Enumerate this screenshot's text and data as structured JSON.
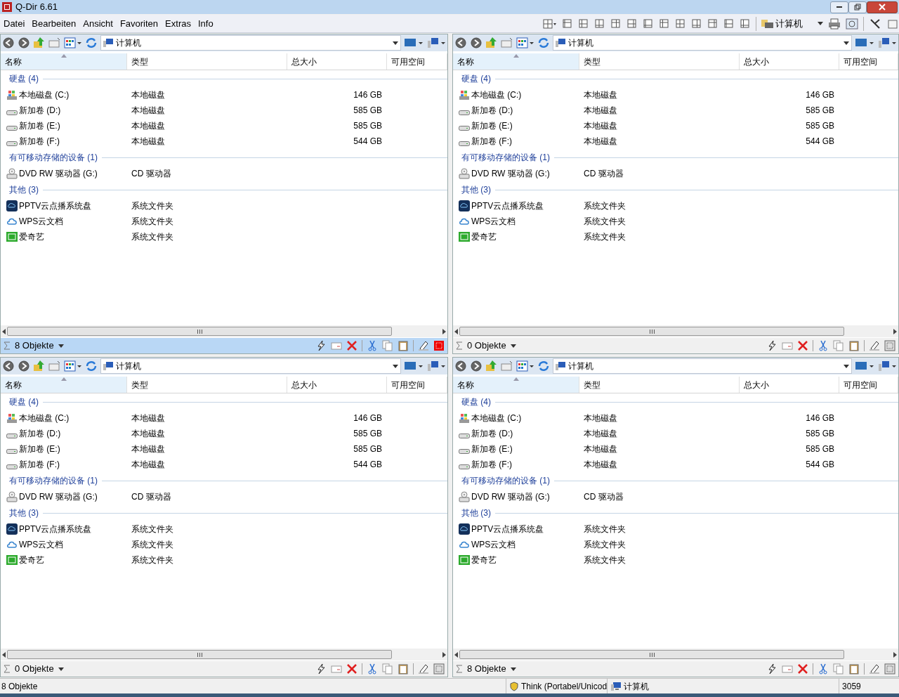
{
  "window": {
    "title": "Q-Dir 6.61"
  },
  "menu": [
    "Datei",
    "Bearbeiten",
    "Ansicht",
    "Favoriten",
    "Extras",
    "Info"
  ],
  "layout_toolbar": {
    "location": "计算机"
  },
  "panes": [
    {
      "active": true,
      "address": "计算机",
      "columns": [
        "名称",
        "类型",
        "总大小",
        "可用空间"
      ],
      "groups": [
        {
          "title": "硬盘 (4)",
          "items": [
            {
              "kind": "system-drive",
              "name": "本地磁盘 (C:)",
              "type": "本地磁盘",
              "size": "146 GB"
            },
            {
              "kind": "drive",
              "name": "新加卷 (D:)",
              "type": "本地磁盘",
              "size": "585 GB"
            },
            {
              "kind": "drive",
              "name": "新加卷 (E:)",
              "type": "本地磁盘",
              "size": "585 GB"
            },
            {
              "kind": "drive",
              "name": "新加卷 (F:)",
              "type": "本地磁盘",
              "size": "544 GB"
            }
          ]
        },
        {
          "title": "有可移动存储的设备 (1)",
          "items": [
            {
              "kind": "dvd",
              "name": "DVD RW 驱动器 (G:)",
              "type": "CD 驱动器"
            }
          ]
        },
        {
          "title": "其他 (3)",
          "items": [
            {
              "kind": "tv",
              "name": "PPTV云点播系统盘",
              "type": "系统文件夹"
            },
            {
              "kind": "cloud",
              "name": "WPS云文档",
              "type": "系统文件夹"
            },
            {
              "kind": "video",
              "name": "爱奇艺",
              "type": "系统文件夹"
            }
          ]
        }
      ],
      "status": "8 Objekte"
    },
    {
      "active": false,
      "address": "计算机",
      "columns": [
        "名称",
        "类型",
        "总大小",
        "可用空间"
      ],
      "groups": [
        {
          "title": "硬盘 (4)",
          "items": [
            {
              "kind": "system-drive",
              "name": "本地磁盘 (C:)",
              "type": "本地磁盘",
              "size": "146 GB"
            },
            {
              "kind": "drive",
              "name": "新加卷 (D:)",
              "type": "本地磁盘",
              "size": "585 GB"
            },
            {
              "kind": "drive",
              "name": "新加卷 (E:)",
              "type": "本地磁盘",
              "size": "585 GB"
            },
            {
              "kind": "drive",
              "name": "新加卷 (F:)",
              "type": "本地磁盘",
              "size": "544 GB"
            }
          ]
        },
        {
          "title": "有可移动存储的设备 (1)",
          "items": [
            {
              "kind": "dvd",
              "name": "DVD RW 驱动器 (G:)",
              "type": "CD 驱动器"
            }
          ]
        },
        {
          "title": "其他 (3)",
          "items": [
            {
              "kind": "tv",
              "name": "PPTV云点播系统盘",
              "type": "系统文件夹"
            },
            {
              "kind": "cloud",
              "name": "WPS云文档",
              "type": "系统文件夹"
            },
            {
              "kind": "video",
              "name": "爱奇艺",
              "type": "系统文件夹"
            }
          ]
        }
      ],
      "status": "0 Objekte"
    },
    {
      "active": false,
      "address": "计算机",
      "columns": [
        "名称",
        "类型",
        "总大小",
        "可用空间"
      ],
      "groups": [
        {
          "title": "硬盘 (4)",
          "items": [
            {
              "kind": "system-drive",
              "name": "本地磁盘 (C:)",
              "type": "本地磁盘",
              "size": "146 GB"
            },
            {
              "kind": "drive",
              "name": "新加卷 (D:)",
              "type": "本地磁盘",
              "size": "585 GB"
            },
            {
              "kind": "drive",
              "name": "新加卷 (E:)",
              "type": "本地磁盘",
              "size": "585 GB"
            },
            {
              "kind": "drive",
              "name": "新加卷 (F:)",
              "type": "本地磁盘",
              "size": "544 GB"
            }
          ]
        },
        {
          "title": "有可移动存储的设备 (1)",
          "items": [
            {
              "kind": "dvd",
              "name": "DVD RW 驱动器 (G:)",
              "type": "CD 驱动器"
            }
          ]
        },
        {
          "title": "其他 (3)",
          "items": [
            {
              "kind": "tv",
              "name": "PPTV云点播系统盘",
              "type": "系统文件夹"
            },
            {
              "kind": "cloud",
              "name": "WPS云文档",
              "type": "系统文件夹"
            },
            {
              "kind": "video",
              "name": "爱奇艺",
              "type": "系统文件夹"
            }
          ]
        }
      ],
      "status": "0 Objekte"
    },
    {
      "active": false,
      "address": "计算机",
      "columns": [
        "名称",
        "类型",
        "总大小",
        "可用空间"
      ],
      "groups": [
        {
          "title": "硬盘 (4)",
          "items": [
            {
              "kind": "system-drive",
              "name": "本地磁盘 (C:)",
              "type": "本地磁盘",
              "size": "146 GB"
            },
            {
              "kind": "drive",
              "name": "新加卷 (D:)",
              "type": "本地磁盘",
              "size": "585 GB"
            },
            {
              "kind": "drive",
              "name": "新加卷 (E:)",
              "type": "本地磁盘",
              "size": "585 GB"
            },
            {
              "kind": "drive",
              "name": "新加卷 (F:)",
              "type": "本地磁盘",
              "size": "544 GB"
            }
          ]
        },
        {
          "title": "有可移动存储的设备 (1)",
          "items": [
            {
              "kind": "dvd",
              "name": "DVD RW 驱动器 (G:)",
              "type": "CD 驱动器"
            }
          ]
        },
        {
          "title": "其他 (3)",
          "items": [
            {
              "kind": "tv",
              "name": "PPTV云点播系统盘",
              "type": "系统文件夹"
            },
            {
              "kind": "cloud",
              "name": "WPS云文档",
              "type": "系统文件夹"
            },
            {
              "kind": "video",
              "name": "爱奇艺",
              "type": "系统文件夹"
            }
          ]
        }
      ],
      "status": "8 Objekte"
    }
  ],
  "status_bar": {
    "count": "8 Objekte",
    "user": "Think (Portabel/Unicod",
    "location": "计算机",
    "number": "3059"
  }
}
